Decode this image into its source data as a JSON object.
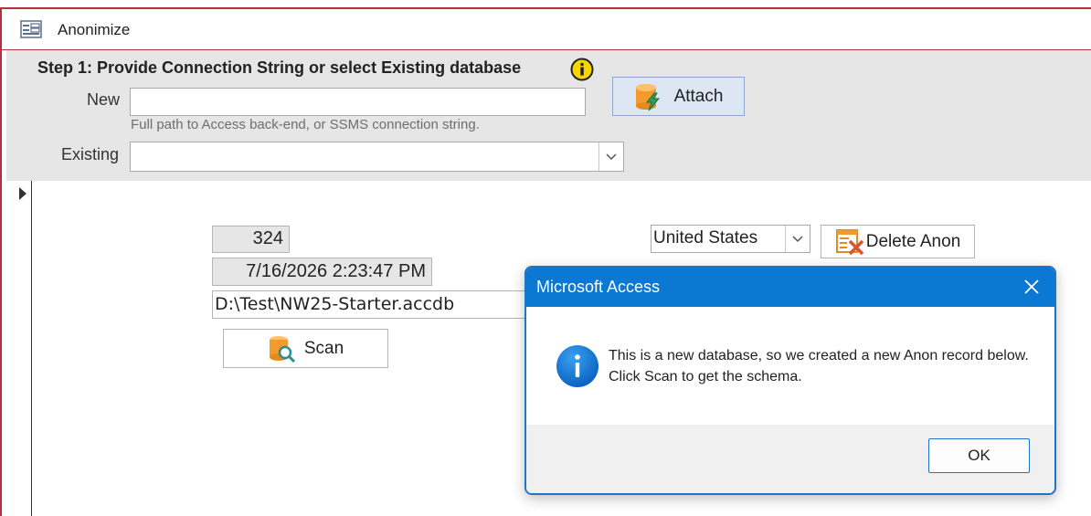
{
  "window": {
    "title": "Anonimize"
  },
  "step1": {
    "heading": "Step 1: Provide Connection String or select Existing database",
    "new_label": "New",
    "new_value": "",
    "hint": "Full path to Access back-end, or SSMS connection string.",
    "existing_label": "Existing",
    "existing_value": "",
    "attach_label": "Attach"
  },
  "record": {
    "id": "324",
    "timestamp": "7/16/2026 2:23:47 PM",
    "path": "D:\\Test\\NW25-Starter.accdb",
    "country": "United States",
    "scan_label": "Scan",
    "delete_label": "Delete Anon"
  },
  "dialog": {
    "title": "Microsoft Access",
    "message": "This is a new database, so we created a new Anon record below. Click Scan to get the schema.",
    "ok_label": "OK"
  },
  "colors": {
    "accent": "#0b78d4",
    "frame": "#b5303a",
    "header_bg": "#e6e6e6"
  }
}
